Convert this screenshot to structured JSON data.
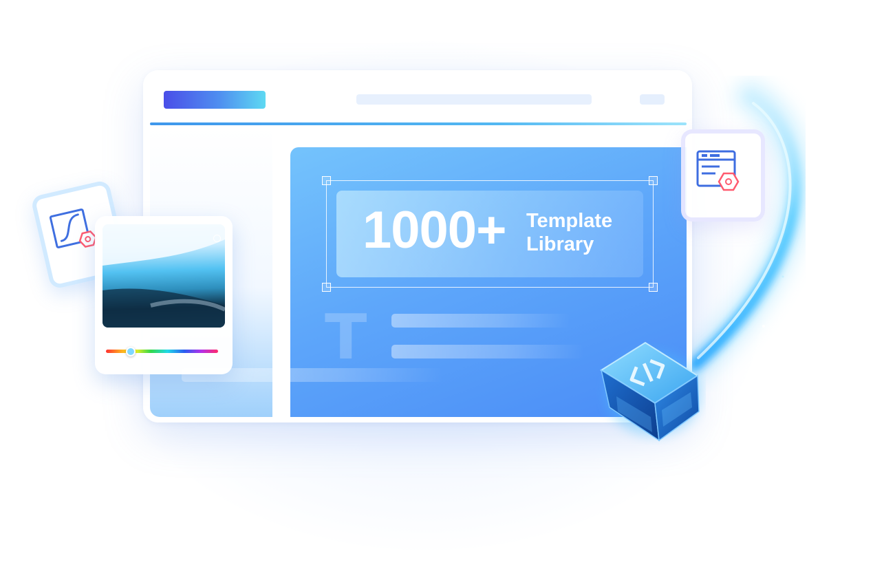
{
  "hero": {
    "count": "1000+",
    "label_line1": "Template",
    "label_line2": "Library"
  },
  "canvas": {
    "text_tool_glyph": "T"
  },
  "color_picker": {
    "hue_position": 0.22
  },
  "icons": {
    "curve_card": "bezier-curve-icon",
    "template_card": "template-layout-icon",
    "cube": "code-cube-icon"
  },
  "colors": {
    "accent_blue": "#4a8cf7",
    "light_blue": "#74c3fc",
    "logo_bar_start": "#4a4ee8",
    "logo_bar_end": "#5ed9f2"
  }
}
